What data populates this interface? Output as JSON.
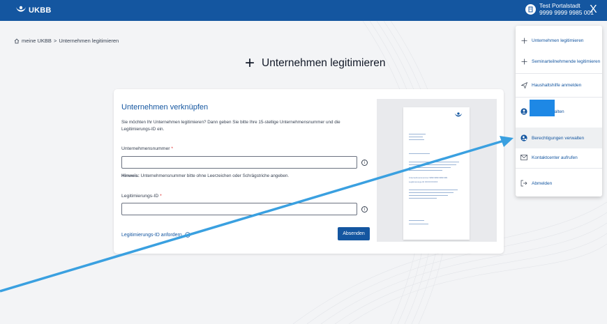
{
  "header": {
    "brand": "UKBB",
    "user_name": "Test Portalstadt",
    "user_id": "9999 9999 9985 001",
    "close_symbol": "X",
    "brand_color": "#1456a0"
  },
  "breadcrumb": {
    "home": "meine UKBB",
    "separator": ">",
    "current": "Unternehmen legitimieren"
  },
  "page": {
    "title_icon": "+",
    "title": "Unternehmen legitimieren"
  },
  "form": {
    "heading": "Unternehmen verknüpfen",
    "intro": "Sie möchten Ihr Unternehmen legitimieren? Dann geben Sie bitte Ihre 15-stellige Unternehmensnummer und die Legitimierungs-ID ein.",
    "field1_label": "Unternehmensnummer",
    "field1_value": "",
    "required_mark": "*",
    "hint_bold": "Hinweis:",
    "hint_text": " Unternehmensnummer bitte ohne Leerzeichen oder Schrägstriche angeben.",
    "field2_label": "Legitimierungs-ID",
    "field2_value": "",
    "request_link": "Legitimierungs-ID anfordern",
    "submit": "Absenden",
    "info_symbol": "i"
  },
  "document_preview": {
    "line1": "Unternehmensnummer   9999 9999 9999 999",
    "line2": "Legitimierungs-ID      XXXXXXXXXX"
  },
  "menu": {
    "items": [
      {
        "label": "Unternehmen legitimieren",
        "icon": "plus-icon"
      },
      {
        "label": "Seminarteilnehmende legitimieren",
        "icon": "plus-icon"
      },
      {
        "label": "Haushaltshilfe anmelden",
        "icon": "send-icon"
      },
      {
        "label": "Konto verwalten",
        "icon": "user-circle-icon"
      },
      {
        "label": "Berechtigungen verwalten",
        "icon": "user-lock-icon"
      },
      {
        "label": "Kontaktcenter aufrufen",
        "icon": "mail-icon"
      },
      {
        "label": "Abmelden",
        "icon": "logout-icon"
      }
    ]
  },
  "annotation": {
    "arrow_color": "#3aa0e0",
    "redaction_color": "#1e88e5"
  }
}
